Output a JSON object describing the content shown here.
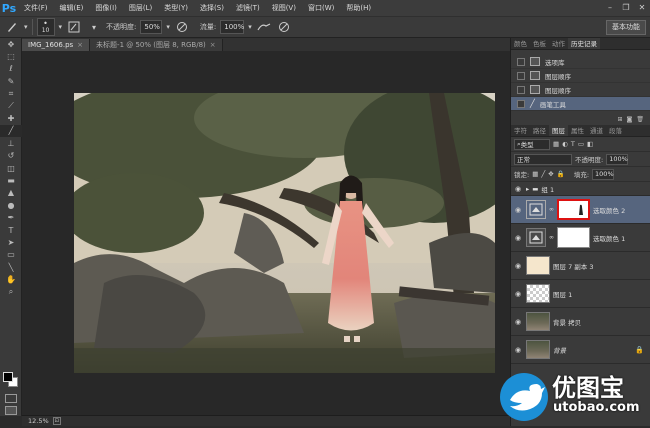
{
  "app": {
    "logo": "Ps"
  },
  "menu": [
    "文件(F)",
    "编辑(E)",
    "图像(I)",
    "图层(L)",
    "类型(Y)",
    "选择(S)",
    "滤镜(T)",
    "视图(V)",
    "窗口(W)",
    "帮助(H)"
  ],
  "options": {
    "brush_size": "10",
    "opacity_label": "不透明度:",
    "opacity_value": "50%",
    "flow_label": "流量:",
    "flow_value": "100%",
    "workspace": "基本功能"
  },
  "tabs": [
    {
      "label": "IMG_1606.ps"
    },
    {
      "label": "未标题-1 @ 50% (图层 8, RGB/8)"
    }
  ],
  "status": {
    "zoom": "12.5%"
  },
  "history_panel": {
    "tabs": [
      "颜色",
      "色板",
      "动作",
      "历史记录"
    ],
    "items": [
      {
        "label": "选项库"
      },
      {
        "label": "图层顺序"
      },
      {
        "label": "图层顺序"
      },
      {
        "label": "画笔工具"
      }
    ]
  },
  "layers_panel": {
    "tabs": [
      "字符",
      "路径",
      "图层",
      "属性",
      "通道",
      "段落"
    ],
    "filter": "类型",
    "blend_mode": "正常",
    "opacity_label": "不透明度:",
    "opacity_value": "100%",
    "lock_label": "锁定:",
    "fill_label": "填充:",
    "fill_value": "100%",
    "group_name": "组 1",
    "layers": [
      {
        "name": "选取颜色 2"
      },
      {
        "name": "选取颜色 1"
      },
      {
        "name": "图层 7 副本 3"
      },
      {
        "name": "图层 1"
      },
      {
        "name": "背景 拷贝"
      },
      {
        "name": "背景"
      }
    ]
  },
  "watermark": {
    "brand": "优图宝",
    "url": "utobao.com"
  },
  "colors": {
    "accent": "#31a8ff",
    "selection": "#56657e",
    "mask_highlight": "#dd1111"
  }
}
